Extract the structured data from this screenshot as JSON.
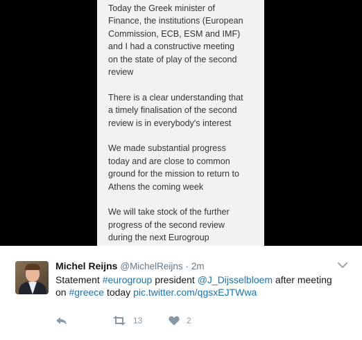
{
  "media": {
    "paragraphs": [
      "Today the Greek minister of\nFinance, the institutions (European\nCommission, ECB, ESM and IMF)\nand I had a constructive meeting\non the state of play of the second\nreview",
      "There is a clear understanding that\na timely finalisation of the second\nreview is in everybody's interest",
      "We made substantial progress\ntoday and are close to common\nground for the mission to return to\nAthens the coming week",
      "We will take stock of the further\nprogress of the second review\nduring the next Eurogroup"
    ]
  },
  "tweet": {
    "author_name": "Michel Reijns",
    "author_handle": "@MichelReijns",
    "separator": "·",
    "time": "2m",
    "text_parts": {
      "p1": "Statement ",
      "hashtag1": "#eurogroup",
      "p2": " president ",
      "mention": "@J_Dijsselbloem",
      "p3": " after meeting",
      "p4": "on ",
      "hashtag2": "#greece",
      "p5": " today ",
      "pic_link": "pic.twitter.com/qgsxEJTWwa"
    },
    "retweet_count": "13",
    "like_count": "2"
  },
  "icons": {
    "reply": "reply-icon",
    "retweet": "retweet-icon",
    "like": "heart-icon",
    "more": "chevron-down-icon"
  },
  "colors": {
    "link": "#1a73b5",
    "meta": "#657786",
    "action": "#8899a6"
  }
}
